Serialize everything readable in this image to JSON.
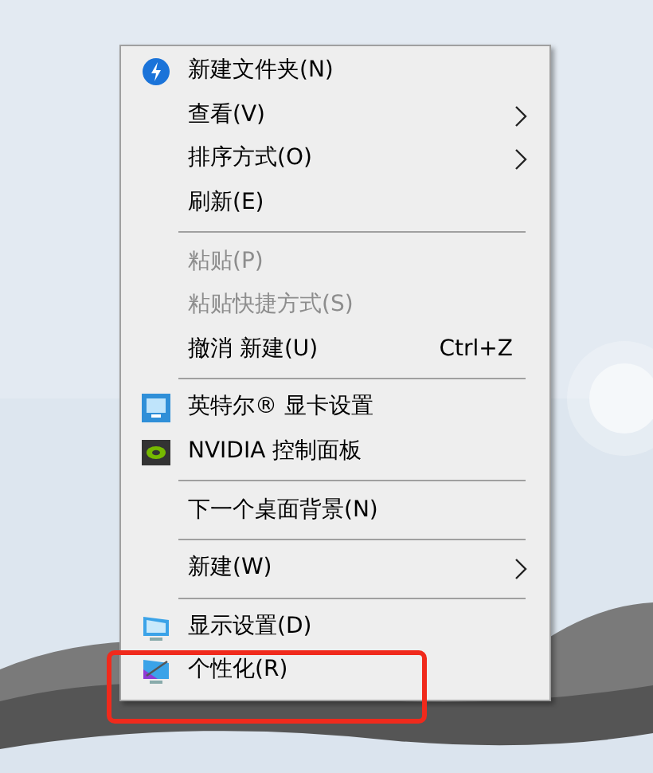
{
  "menu": {
    "items": [
      {
        "kind": "command",
        "label": "新建文件夹(N)",
        "disabled": false,
        "submenu": false,
        "highlighted": false
      },
      {
        "kind": "command",
        "label": "查看(V)",
        "disabled": false,
        "submenu": true,
        "highlighted": false
      },
      {
        "kind": "command",
        "label": "排序方式(O)",
        "disabled": false,
        "submenu": true,
        "highlighted": false
      },
      {
        "kind": "command",
        "label": "刷新(E)",
        "disabled": false,
        "submenu": false,
        "highlighted": false
      },
      {
        "kind": "separator"
      },
      {
        "kind": "command",
        "label": "粘贴(P)",
        "disabled": true,
        "submenu": false,
        "highlighted": false
      },
      {
        "kind": "command",
        "label": "粘贴快捷方式(S)",
        "disabled": true,
        "submenu": false,
        "highlighted": false
      },
      {
        "kind": "command",
        "label": "撤消 新建(U)",
        "shortcut": "Ctrl+Z",
        "disabled": false,
        "submenu": false,
        "highlighted": false
      },
      {
        "kind": "separator"
      },
      {
        "kind": "command",
        "label": "英特尔® 显卡设置",
        "disabled": false,
        "submenu": false,
        "highlighted": false
      },
      {
        "kind": "command",
        "label": "NVIDIA 控制面板",
        "disabled": false,
        "submenu": false,
        "highlighted": false
      },
      {
        "kind": "separator"
      },
      {
        "kind": "command",
        "label": "下一个桌面背景(N)",
        "disabled": false,
        "submenu": false,
        "highlighted": false
      },
      {
        "kind": "separator"
      },
      {
        "kind": "command",
        "label": "新建(W)",
        "disabled": false,
        "submenu": true,
        "highlighted": false
      },
      {
        "kind": "separator"
      },
      {
        "kind": "command",
        "label": "显示设置(D)",
        "disabled": false,
        "submenu": false,
        "highlighted": false
      },
      {
        "kind": "command",
        "label": "个性化(R)",
        "disabled": false,
        "submenu": false,
        "highlighted": true
      }
    ]
  }
}
